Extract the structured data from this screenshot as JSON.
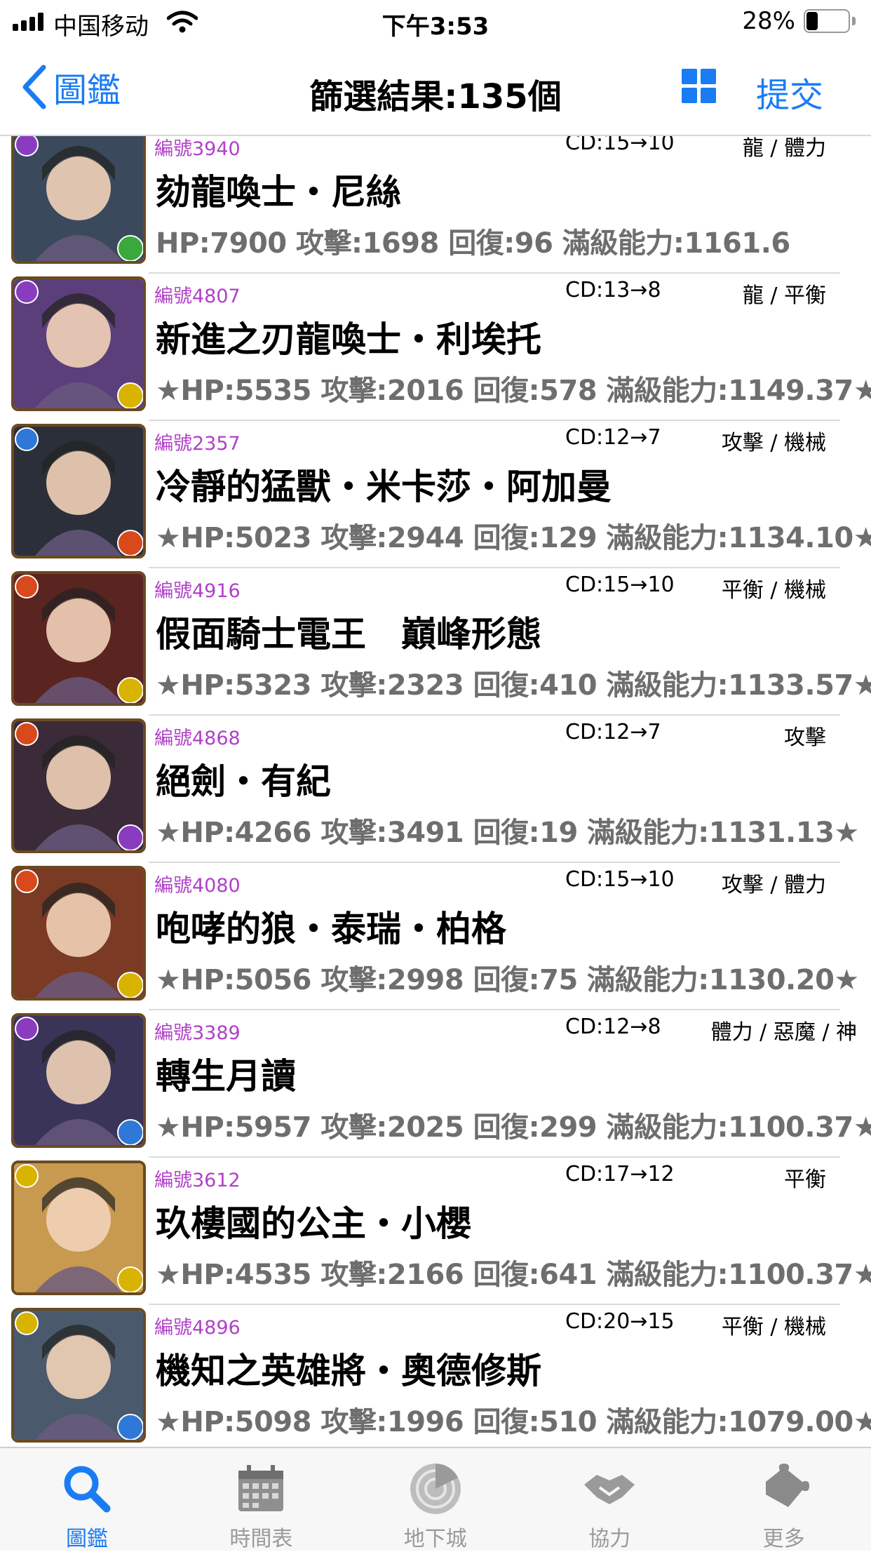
{
  "status_bar": {
    "carrier": "中国移动",
    "time": "下午3:53",
    "battery_percent": "28%",
    "battery_level": 0.28
  },
  "nav": {
    "back_label": "圖鑑",
    "title": "篩選結果:135個",
    "submit_label": "提交"
  },
  "colors": {
    "accent": "#1a7cf4",
    "number": "#b040c8",
    "stats": "#6e6e6e"
  },
  "cards": [
    {
      "number": "編號3940",
      "cd": "CD:15→10",
      "types": "龍 / 體力",
      "name": "劾龍喚士・尼絲",
      "stats": "HP:7900 攻擊:1698 回復:96 滿級能力:1161.6",
      "attr": [
        "purple",
        "green"
      ]
    },
    {
      "number": "編號4807",
      "cd": "CD:13→8",
      "types": "龍 / 平衡",
      "name": "新進之刃龍喚士・利埃托",
      "stats": "★HP:5535 攻擊:2016 回復:578 滿級能力:1149.37★",
      "attr": [
        "purple",
        "yellow"
      ]
    },
    {
      "number": "編號2357",
      "cd": "CD:12→7",
      "types": "攻擊 / 機械",
      "name": "冷靜的猛獸・米卡莎・阿加曼",
      "stats": "★HP:5023 攻擊:2944 回復:129 滿級能力:1134.10★",
      "attr": [
        "blue",
        "red"
      ]
    },
    {
      "number": "編號4916",
      "cd": "CD:15→10",
      "types": "平衡 / 機械",
      "name": "假面騎士電王　巔峰形態",
      "stats": "★HP:5323 攻擊:2323 回復:410 滿級能力:1133.57★",
      "attr": [
        "red",
        "yellow"
      ]
    },
    {
      "number": "編號4868",
      "cd": "CD:12→7",
      "types": "攻擊",
      "name": "絕劍・有紀",
      "stats": "★HP:4266 攻擊:3491 回復:19 滿級能力:1131.13★",
      "attr": [
        "red",
        "purple"
      ]
    },
    {
      "number": "編號4080",
      "cd": "CD:15→10",
      "types": "攻擊 / 體力",
      "name": "咆哮的狼・泰瑞・柏格",
      "stats": "★HP:5056 攻擊:2998 回復:75 滿級能力:1130.20★",
      "attr": [
        "red",
        "yellow"
      ]
    },
    {
      "number": "編號3389",
      "cd": "CD:12→8",
      "types": "體力 / 惡魔 / 神",
      "name": "轉生月讀",
      "stats": "★HP:5957 攻擊:2025 回復:299 滿級能力:1100.37★",
      "attr": [
        "purple",
        "blue"
      ]
    },
    {
      "number": "編號3612",
      "cd": "CD:17→12",
      "types": "平衡",
      "name": "玖樓國的公主・小櫻",
      "stats": "★HP:4535 攻擊:2166 回復:641 滿級能力:1100.37★",
      "attr": [
        "yellow",
        "yellow"
      ]
    },
    {
      "number": "編號4896",
      "cd": "CD:20→15",
      "types": "平衡 / 機械",
      "name": "機知之英雄將・奧德修斯",
      "stats": "★HP:5098 攻擊:1996 回復:510 滿級能力:1079.00★",
      "attr": [
        "yellow",
        "blue"
      ]
    }
  ],
  "tabs": [
    {
      "label": "圖鑑",
      "icon": "search-icon",
      "active": true
    },
    {
      "label": "時間表",
      "icon": "calendar-icon",
      "active": false
    },
    {
      "label": "地下城",
      "icon": "radar-icon",
      "active": false
    },
    {
      "label": "協力",
      "icon": "handshake-icon",
      "active": false
    },
    {
      "label": "更多",
      "icon": "puzzle-icon",
      "active": false
    }
  ]
}
